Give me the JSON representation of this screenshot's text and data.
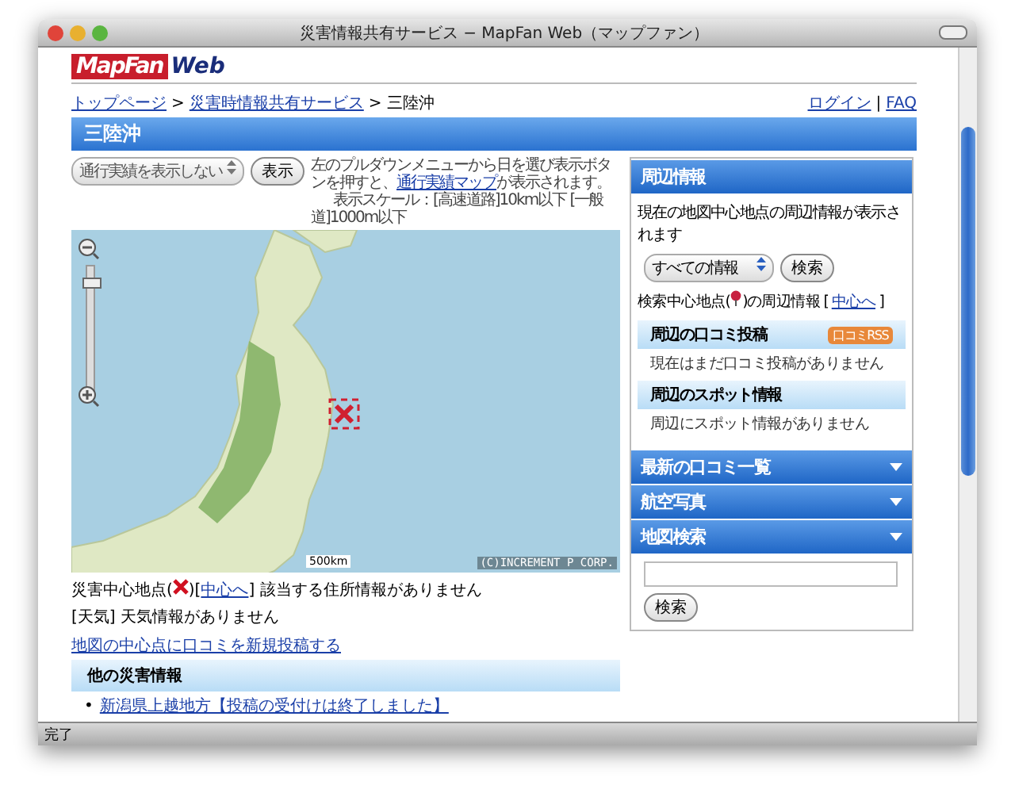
{
  "window": {
    "title": "災害情報共有サービス − MapFan Web（マップファン）"
  },
  "logo": {
    "main": "MapFan",
    "sub": "Web"
  },
  "breadcrumb": [
    {
      "label": "トップページ",
      "kind": "link"
    },
    {
      "label": "災害時情報共有サービス",
      "kind": "link"
    },
    {
      "label": "三陸沖",
      "kind": "current"
    }
  ],
  "breadcrumb_separator": ">",
  "header_links": [
    "ログイン",
    "FAQ"
  ],
  "header_separator": "|",
  "page_title": "三陸沖",
  "controls": {
    "select": "通行実績を表示しない",
    "button": "表示",
    "help_before": "左のプルダウンメニューから日を選び表示ボタンを押すと、",
    "help_link": "通行実績マップ",
    "help_after": "が表示されます。",
    "scale_info": "表示スケール：[高速道路]10km以下 [一般道]1000m以下"
  },
  "map": {
    "zoom_slider": {
      "level": 0.9
    },
    "scale": "500km",
    "copyright": "(C)INCREMENT P CORP."
  },
  "disaster_center": {
    "before": "災害中心地点(",
    "middle": ")[",
    "link": "中心へ",
    "after": "] 該当する住所情報がありません"
  },
  "weather": "[天気] 天気情報がありません",
  "post_link": "地図の中心点に口コミを新規投稿する",
  "other_disasters": {
    "title": "他の災害情報",
    "bullet": "•",
    "items": [
      "新潟県上越地方【投稿の受付けは終了しました】"
    ]
  },
  "nearby": {
    "title": "周辺情報",
    "description": "現在の地図中心地点の周辺情報が表示されます",
    "select": "すべての情報",
    "button": "検索",
    "center_before": "検索中心地点(",
    "center_middle": ")の周辺情報 [ ",
    "center_link": "中心へ",
    "center_after": " ]",
    "sections": [
      {
        "title": "周辺の口コミ投稿",
        "badge": "口コミRSS",
        "text": "現在はまだ口コミ投稿がありません"
      },
      {
        "title": "周辺のスポット情報",
        "text": "周辺にスポット情報がありません"
      }
    ]
  },
  "menus": [
    {
      "label": "最新の口コミ一覧"
    },
    {
      "label": "航空写真"
    },
    {
      "label": "地図検索",
      "button": "検索"
    }
  ],
  "status_bar": "完了"
}
